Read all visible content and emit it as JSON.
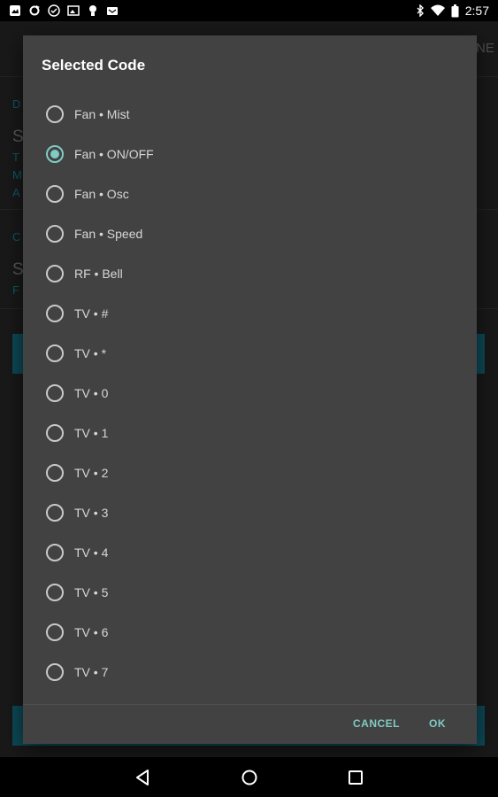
{
  "status_bar": {
    "time": "2:57",
    "left_icons": [
      "gallery-icon",
      "sync-icon",
      "check-circle-icon",
      "photo-icon",
      "lightbulb-icon",
      "inbox-icon"
    ],
    "right_icons": [
      "bluetooth-icon",
      "wifi-icon",
      "battery-icon"
    ]
  },
  "background": {
    "partial_texts": [
      "NE",
      "D",
      "S",
      "T",
      "M",
      "A",
      "C",
      "S",
      "F"
    ]
  },
  "dialog": {
    "title": "Selected Code",
    "options": [
      {
        "label": "Fan • Mist",
        "checked": false
      },
      {
        "label": "Fan • ON/OFF",
        "checked": true
      },
      {
        "label": "Fan • Osc",
        "checked": false
      },
      {
        "label": "Fan • Speed",
        "checked": false
      },
      {
        "label": "RF • Bell",
        "checked": false
      },
      {
        "label": "TV • #",
        "checked": false
      },
      {
        "label": "TV • *",
        "checked": false
      },
      {
        "label": "TV • 0",
        "checked": false
      },
      {
        "label": "TV • 1",
        "checked": false
      },
      {
        "label": "TV • 2",
        "checked": false
      },
      {
        "label": "TV • 3",
        "checked": false
      },
      {
        "label": "TV • 4",
        "checked": false
      },
      {
        "label": "TV • 5",
        "checked": false
      },
      {
        "label": "TV • 6",
        "checked": false
      },
      {
        "label": "TV • 7",
        "checked": false
      }
    ],
    "cancel_label": "CANCEL",
    "ok_label": "OK"
  },
  "colors": {
    "accent": "#80cbc4",
    "dialog_bg": "#424242",
    "background": "#191919"
  },
  "nav_bar": {
    "icons": [
      "back-icon",
      "home-icon",
      "recents-icon"
    ]
  }
}
